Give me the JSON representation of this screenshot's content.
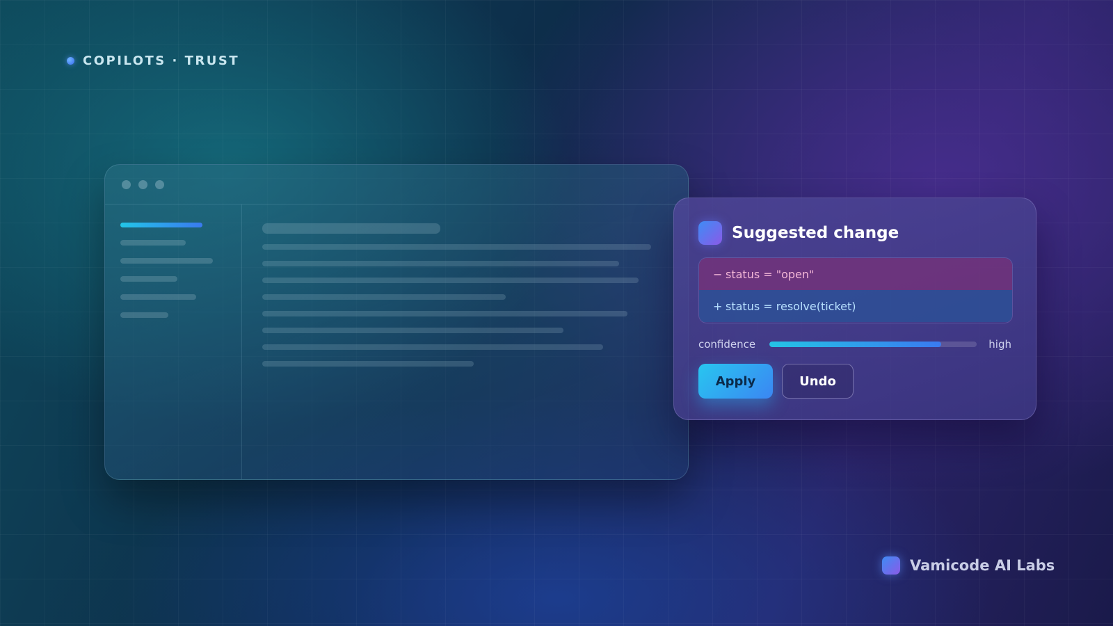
{
  "eyebrow": {
    "text": "COPILOTS · TRUST",
    "icon": "dot-icon"
  },
  "app_window": {
    "traffic_lights": [
      "window-dot-icon",
      "window-dot-icon",
      "window-dot-icon"
    ],
    "sidebar_placeholder_count": 6,
    "content_placeholder_count": 9
  },
  "suggestion": {
    "icon": "suggestion-icon",
    "title": "Suggested change",
    "diff": {
      "removed": {
        "sign": "−",
        "code": "status = \"open\""
      },
      "added": {
        "sign": "+",
        "code": "status = resolve(ticket)"
      }
    },
    "confidence": {
      "label": "confidence",
      "level_label": "high",
      "value_percent": 83
    },
    "buttons": {
      "apply": "Apply",
      "undo": "Undo"
    }
  },
  "brand": {
    "name": "Vamicode AI Labs",
    "icon": "brand-logo-icon"
  },
  "colors": {
    "accent_cyan": "#22c6e8",
    "accent_blue": "#3a7af0",
    "diff_removed_bg": "#7a3278",
    "diff_added_bg": "#2d5096"
  }
}
